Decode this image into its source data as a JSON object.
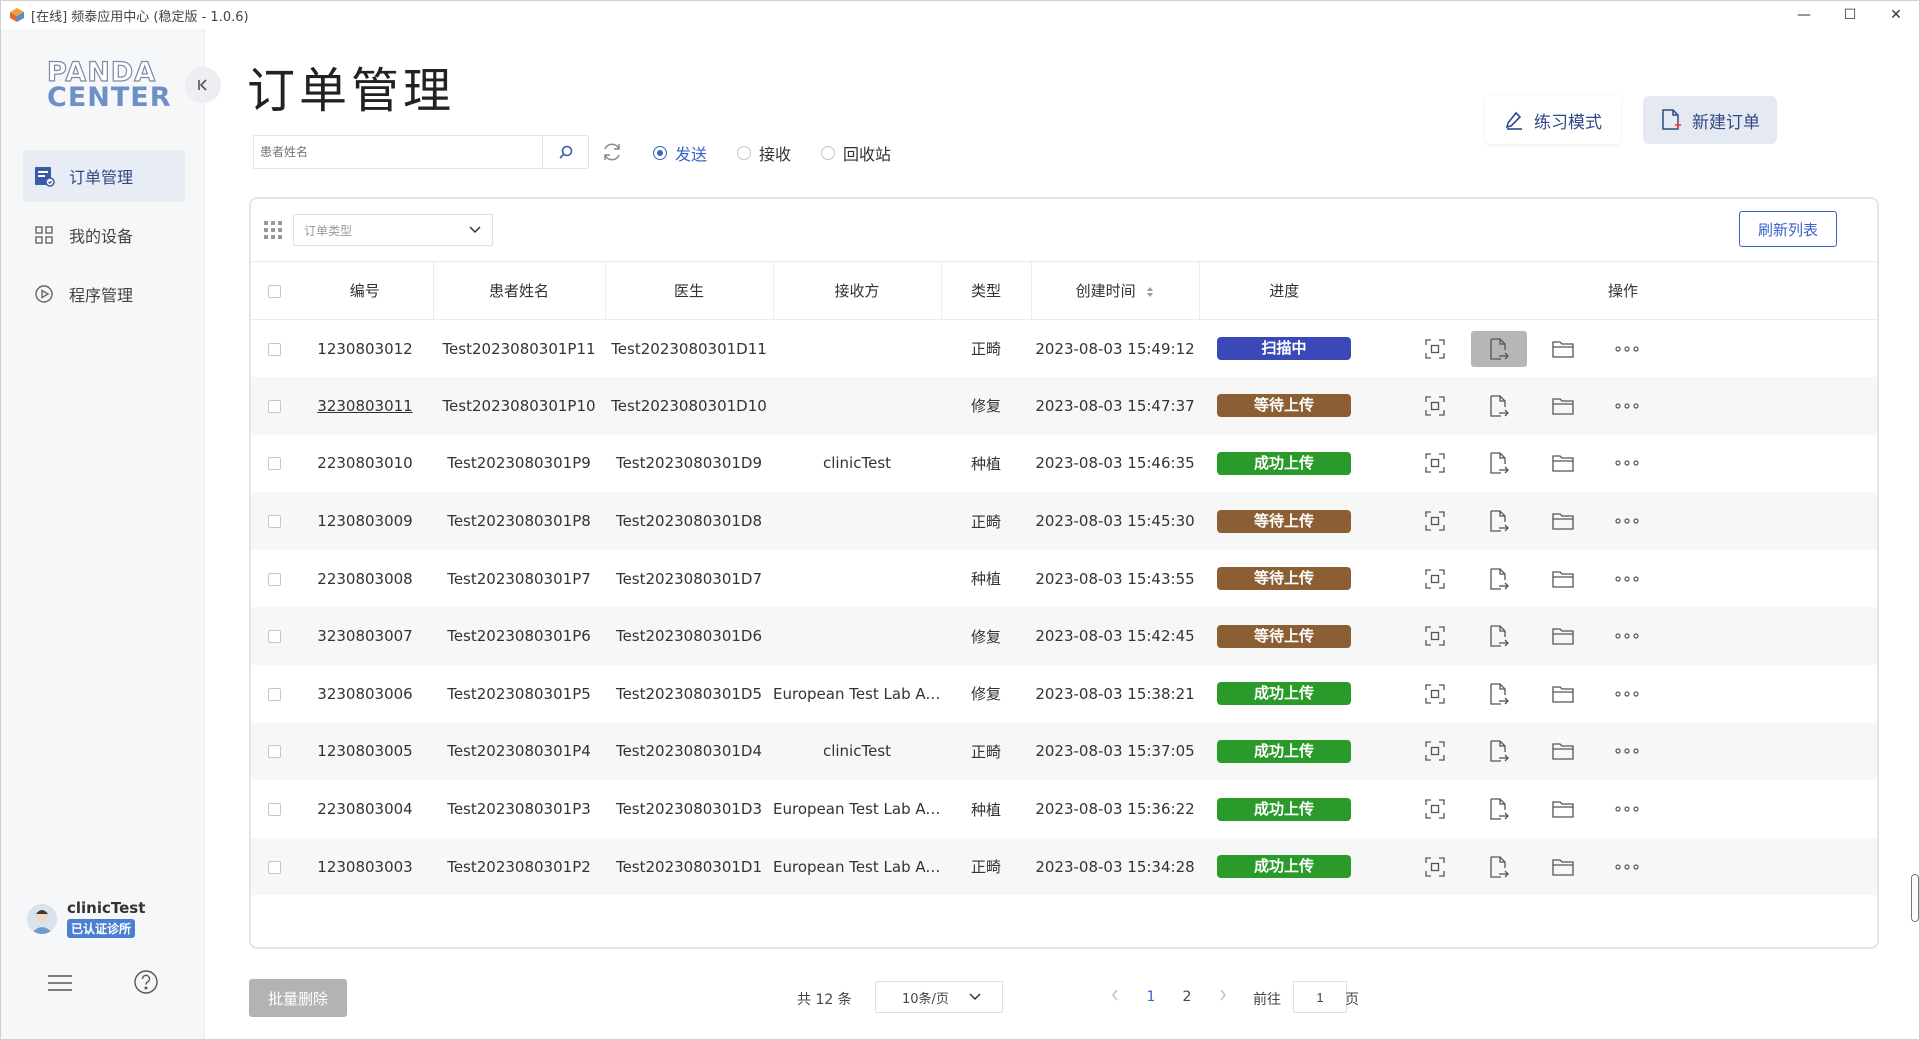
{
  "window": {
    "title": "[在线] 频泰应用中心 (稳定版 - 1.0.6)",
    "minimize": "—",
    "maximize": "☐",
    "close": "✕"
  },
  "sidebar": {
    "logo_line1": "PANDA",
    "logo_line2": "CENTER",
    "items": [
      {
        "label": "订单管理",
        "icon": "order-doc-icon",
        "active": true
      },
      {
        "label": "我的设备",
        "icon": "device-grid-icon",
        "active": false
      },
      {
        "label": "程序管理",
        "icon": "play-circle-icon",
        "active": false
      }
    ],
    "user": {
      "name": "clinicTest",
      "badge": "已认证诊所"
    }
  },
  "main": {
    "title": "订单管理",
    "search": {
      "placeholder": "患者姓名",
      "value": ""
    },
    "radios": [
      {
        "label": "发送",
        "checked": true
      },
      {
        "label": "接收",
        "checked": false
      },
      {
        "label": "回收站",
        "checked": false
      }
    ],
    "practice_btn": "练习模式",
    "new_order_btn": "新建订单",
    "type_select_placeholder": "订单类型",
    "refresh_list": "刷新列表"
  },
  "table": {
    "headers": [
      "编号",
      "患者姓名",
      "医生",
      "接收方",
      "类型",
      "创建时间",
      "进度",
      "操作"
    ],
    "rows": [
      {
        "id": "1230803012",
        "patient": "Test2023080301P11",
        "doctor": "Test2023080301D11",
        "receiver": "",
        "type": "正畸",
        "created": "2023-08-03 15:49:12",
        "status": "扫描中",
        "status_color": "#3b49b8",
        "underline": false
      },
      {
        "id": "3230803011",
        "patient": "Test2023080301P10",
        "doctor": "Test2023080301D10",
        "receiver": "",
        "type": "修复",
        "created": "2023-08-03 15:47:37",
        "status": "等待上传",
        "status_color": "#8b5e34",
        "underline": true
      },
      {
        "id": "2230803010",
        "patient": "Test2023080301P9",
        "doctor": "Test2023080301D9",
        "receiver": "clinicTest",
        "type": "种植",
        "created": "2023-08-03 15:46:35",
        "status": "成功上传",
        "status_color": "#2a9a2a",
        "underline": false
      },
      {
        "id": "1230803009",
        "patient": "Test2023080301P8",
        "doctor": "Test2023080301D8",
        "receiver": "",
        "type": "正畸",
        "created": "2023-08-03 15:45:30",
        "status": "等待上传",
        "status_color": "#8b5e34",
        "underline": false
      },
      {
        "id": "2230803008",
        "patient": "Test2023080301P7",
        "doctor": "Test2023080301D7",
        "receiver": "",
        "type": "种植",
        "created": "2023-08-03 15:43:55",
        "status": "等待上传",
        "status_color": "#8b5e34",
        "underline": false
      },
      {
        "id": "3230803007",
        "patient": "Test2023080301P6",
        "doctor": "Test2023080301D6",
        "receiver": "",
        "type": "修复",
        "created": "2023-08-03 15:42:45",
        "status": "等待上传",
        "status_color": "#8b5e34",
        "underline": false
      },
      {
        "id": "3230803006",
        "patient": "Test2023080301P5",
        "doctor": "Test2023080301D5",
        "receiver": "European Test Lab Acc...",
        "type": "修复",
        "created": "2023-08-03 15:38:21",
        "status": "成功上传",
        "status_color": "#2a9a2a",
        "underline": false
      },
      {
        "id": "1230803005",
        "patient": "Test2023080301P4",
        "doctor": "Test2023080301D4",
        "receiver": "clinicTest",
        "type": "正畸",
        "created": "2023-08-03 15:37:05",
        "status": "成功上传",
        "status_color": "#2a9a2a",
        "underline": false
      },
      {
        "id": "2230803004",
        "patient": "Test2023080301P3",
        "doctor": "Test2023080301D3",
        "receiver": "European Test Lab Acc...",
        "type": "种植",
        "created": "2023-08-03 15:36:22",
        "status": "成功上传",
        "status_color": "#2a9a2a",
        "underline": false
      },
      {
        "id": "1230803003",
        "patient": "Test2023080301P2",
        "doctor": "Test2023080301D1",
        "receiver": "European Test Lab Acc...",
        "type": "正畸",
        "created": "2023-08-03 15:34:28",
        "status": "成功上传",
        "status_color": "#2a9a2a",
        "underline": false
      }
    ],
    "ops_icons": [
      "scan-frame-icon",
      "export-file-icon",
      "folder-icon",
      "more-dots-icon"
    ]
  },
  "footer": {
    "batch_delete": "批量删除",
    "total": "共 12 条",
    "page_size": "10条/页",
    "pages": [
      "1",
      "2"
    ],
    "current_page": "1",
    "goto_prefix": "前往",
    "goto_value": "1",
    "goto_suffix": "页"
  },
  "colors": {
    "accent": "#3a62c9",
    "scanning": "#3b49b8",
    "waiting": "#8b5e34",
    "success": "#2a9a2a"
  }
}
